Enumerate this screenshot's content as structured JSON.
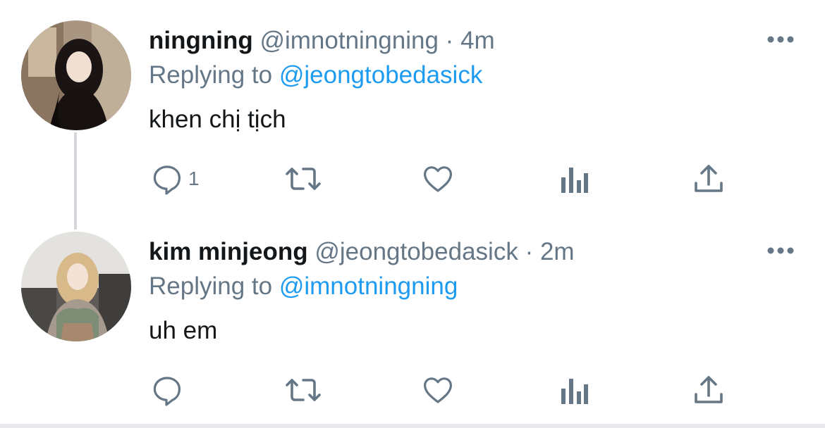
{
  "colors": {
    "text": "#14171a",
    "secondary": "#657786",
    "link": "#1d9bf0",
    "thread_line": "#d4d6d9"
  },
  "tweets": [
    {
      "display_name": "ningning",
      "handle": "@imnotningning",
      "separator": "·",
      "time": "4m",
      "replying_prefix": "Replying to",
      "replying_to": "@jeongtobedasick",
      "text": "khen chị tịch",
      "reply_count": "1",
      "avatar": "ningning-avatar",
      "icons": [
        "reply-icon",
        "retweet-icon",
        "like-icon",
        "analytics-icon",
        "share-icon",
        "more-icon"
      ]
    },
    {
      "display_name": "kim minjeong",
      "handle": "@jeongtobedasick",
      "separator": "·",
      "time": "2m",
      "replying_prefix": "Replying to",
      "replying_to": "@imnotningning",
      "text": "uh em",
      "reply_count": "",
      "avatar": "kim-minjeong-avatar",
      "icons": [
        "reply-icon",
        "retweet-icon",
        "like-icon",
        "analytics-icon",
        "share-icon",
        "more-icon"
      ]
    }
  ]
}
